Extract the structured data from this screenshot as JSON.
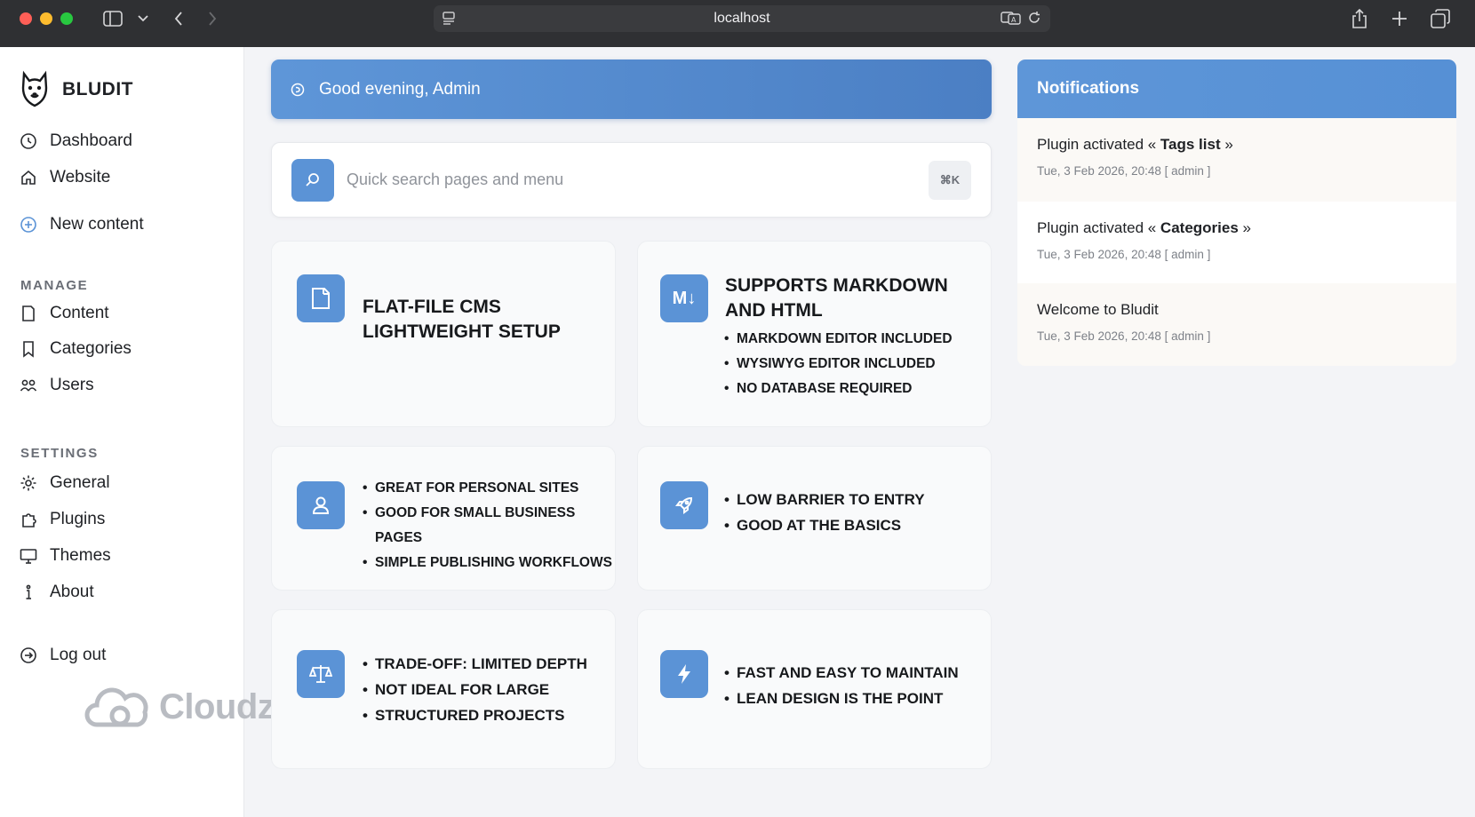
{
  "browser": {
    "url": "localhost"
  },
  "sidebar": {
    "brand": "BLUDIT",
    "items_top": [
      {
        "label": "Dashboard",
        "icon": "dashboard-icon"
      },
      {
        "label": "Website",
        "icon": "home-icon"
      },
      {
        "label": "New content",
        "icon": "plus-circle-icon"
      }
    ],
    "manage_heading": "MANAGE",
    "manage_items": [
      {
        "label": "Content",
        "icon": "document-icon"
      },
      {
        "label": "Categories",
        "icon": "bookmark-icon"
      },
      {
        "label": "Users",
        "icon": "users-icon"
      }
    ],
    "settings_heading": "SETTINGS",
    "settings_items": [
      {
        "label": "General",
        "icon": "gear-icon"
      },
      {
        "label": "Plugins",
        "icon": "puzzle-icon"
      },
      {
        "label": "Themes",
        "icon": "monitor-icon"
      },
      {
        "label": "About",
        "icon": "info-icon"
      }
    ],
    "logout": "Log out"
  },
  "watermark": "Cloudzy",
  "greeting": "Good evening, Admin",
  "search": {
    "placeholder": "Quick search pages and menu",
    "shortcut": "⌘K"
  },
  "cards": [
    {
      "icon": "document-icon",
      "title_lines": [
        "FLAT-FILE CMS",
        "LIGHTWEIGHT SETUP"
      ],
      "items": []
    },
    {
      "icon": "markdown-icon",
      "icon_text": "M↓",
      "title_lines": [
        "SUPPORTS MARKDOWN",
        "AND HTML"
      ],
      "items": [
        "MARKDOWN EDITOR INCLUDED",
        "WYSIWYG EDITOR INCLUDED",
        "NO DATABASE REQUIRED"
      ]
    },
    {
      "icon": "user-icon",
      "title_lines": [],
      "items": [
        "GREAT FOR PERSONAL SITES",
        "GOOD FOR SMALL BUSINESS PAGES",
        "SIMPLE PUBLISHING WORKFLOWS"
      ]
    },
    {
      "icon": "rocket-icon",
      "title_lines": [],
      "items": [
        "LOW BARRIER TO ENTRY",
        "GOOD AT THE BASICS"
      ]
    },
    {
      "icon": "scale-icon",
      "title_lines": [],
      "items": [
        "TRADE-OFF: LIMITED DEPTH",
        "NOT IDEAL FOR LARGE",
        "STRUCTURED PROJECTS"
      ]
    },
    {
      "icon": "bolt-icon",
      "title_lines": [],
      "items": [
        "FAST AND EASY TO MAINTAIN",
        "LEAN DESIGN IS THE POINT"
      ]
    }
  ],
  "notifications": {
    "title": "Notifications",
    "items": [
      {
        "prefix": "Plugin activated « ",
        "bold": "Tags list",
        "suffix": " »",
        "meta": "Tue, 3 Feb 2026, 20:48 [ admin ]"
      },
      {
        "prefix": "Plugin activated « ",
        "bold": "Categories",
        "suffix": " »",
        "meta": "Tue, 3 Feb 2026, 20:48 [ admin ]"
      },
      {
        "prefix": "Welcome to Bludit",
        "bold": "",
        "suffix": "",
        "meta": "Tue, 3 Feb 2026, 20:48 [ admin ]"
      }
    ]
  }
}
